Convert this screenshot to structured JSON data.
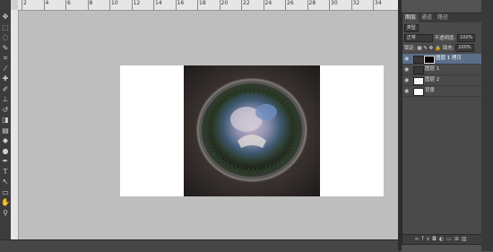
{
  "ruler": {
    "numbers": [
      "2",
      "4",
      "6",
      "8",
      "10",
      "12",
      "14",
      "16",
      "18",
      "20",
      "22",
      "24",
      "26",
      "28",
      "30",
      "32",
      "34"
    ]
  },
  "tools": [
    {
      "icon": "move-icon",
      "glyph": "✥"
    },
    {
      "icon": "marquee-icon",
      "glyph": "⬚"
    },
    {
      "icon": "lasso-icon",
      "glyph": "◌"
    },
    {
      "icon": "quick-select-icon",
      "glyph": "✎"
    },
    {
      "icon": "crop-icon",
      "glyph": "⌗"
    },
    {
      "icon": "eyedropper-icon",
      "glyph": "⁄"
    },
    {
      "icon": "healing-brush-icon",
      "glyph": "✚"
    },
    {
      "icon": "brush-icon",
      "glyph": "✐"
    },
    {
      "icon": "stamp-icon",
      "glyph": "⊥"
    },
    {
      "icon": "history-brush-icon",
      "glyph": "↺"
    },
    {
      "icon": "eraser-icon",
      "glyph": "◨"
    },
    {
      "icon": "gradient-icon",
      "glyph": "▤"
    },
    {
      "icon": "blur-icon",
      "glyph": "◆"
    },
    {
      "icon": "dodge-icon",
      "glyph": "●"
    },
    {
      "icon": "pen-icon",
      "glyph": "✒"
    },
    {
      "icon": "type-icon",
      "glyph": "T"
    },
    {
      "icon": "path-select-icon",
      "glyph": "↖"
    },
    {
      "icon": "shape-icon",
      "glyph": "▭"
    },
    {
      "icon": "hand-icon",
      "glyph": "✋"
    },
    {
      "icon": "zoom-icon",
      "glyph": "⚲"
    }
  ],
  "layers_panel": {
    "tabs": [
      "图层",
      "通道",
      "路径"
    ],
    "filter_label": "类型",
    "blend_mode": "正常",
    "opacity_label": "不透明度:",
    "opacity_value": "100%",
    "lock_label": "锁定:",
    "fill_label": "填充:",
    "fill_value": "100%",
    "layers": [
      {
        "name": "图层 1 拷贝",
        "active": true,
        "has_mask": true
      },
      {
        "name": "图层 1",
        "active": false,
        "has_mask": false
      },
      {
        "name": "图层 2",
        "active": false,
        "has_mask": false
      },
      {
        "name": "背景",
        "active": false,
        "has_mask": false
      }
    ],
    "footer_icons": [
      "link-icon",
      "fx-icon",
      "mask-icon",
      "adjustment-icon",
      "folder-icon",
      "new-layer-icon",
      "trash-icon"
    ]
  },
  "colors": {
    "canvas_bg": "#bebebe",
    "ui_dark": "#535353",
    "selected_layer": "#5b6f8a"
  }
}
